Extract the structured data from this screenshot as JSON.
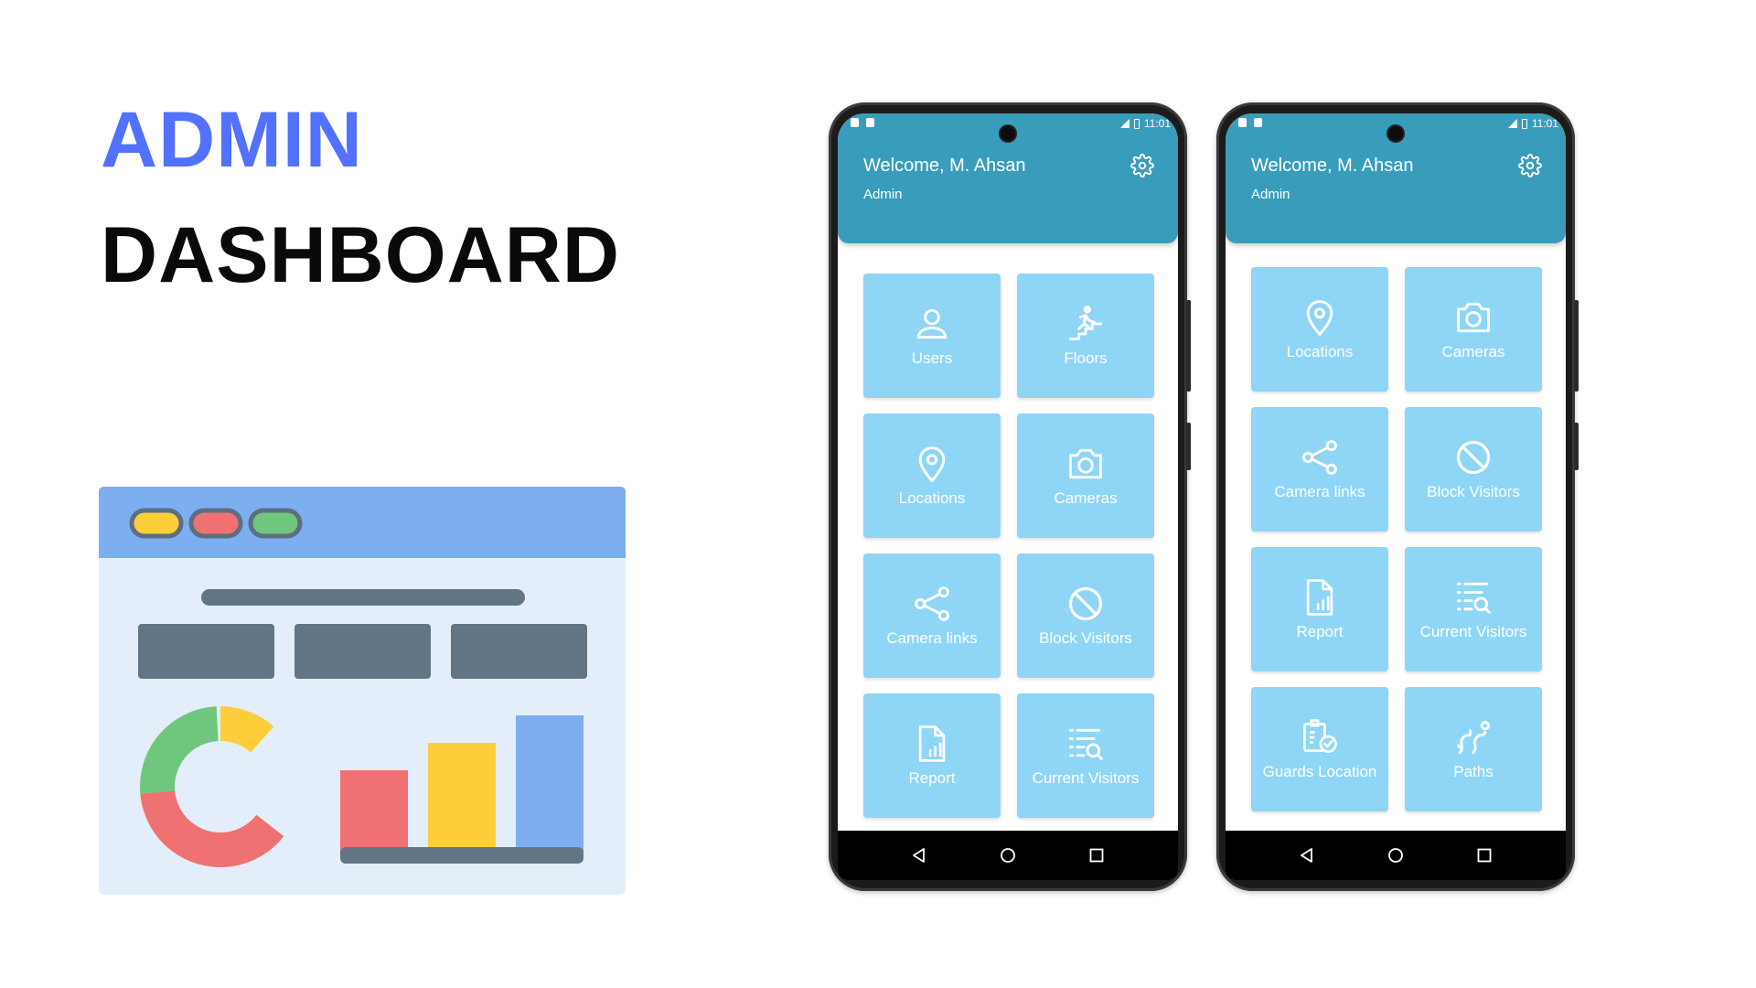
{
  "hero": {
    "line1": "ADMIN",
    "line2": "DASHBOARD"
  },
  "colors": {
    "accent": "#5271ff",
    "appbar": "#3a9cbb",
    "tile": "#8fd5f6",
    "illustration_header": "#7daeef",
    "illustration_body": "#e3eefa"
  },
  "phones": [
    {
      "status_time": "11:01",
      "welcome": "Welcome, M. Ahsan",
      "role": "Admin",
      "tiles": [
        {
          "icon": "user-icon",
          "label": "Users"
        },
        {
          "icon": "stairs-icon",
          "label": "Floors"
        },
        {
          "icon": "location-pin-icon",
          "label": "Locations"
        },
        {
          "icon": "camera-icon",
          "label": "Cameras"
        },
        {
          "icon": "share-icon",
          "label": "Camera links"
        },
        {
          "icon": "block-icon",
          "label": "Block Visitors"
        },
        {
          "icon": "report-icon",
          "label": "Report"
        },
        {
          "icon": "list-search-icon",
          "label": "Current Visitors"
        }
      ]
    },
    {
      "status_time": "11:01",
      "welcome": "Welcome, M. Ahsan",
      "role": "Admin",
      "tiles": [
        {
          "icon": "location-pin-icon",
          "label": "Locations"
        },
        {
          "icon": "camera-icon",
          "label": "Cameras"
        },
        {
          "icon": "share-icon",
          "label": "Camera links"
        },
        {
          "icon": "block-icon",
          "label": "Block Visitors"
        },
        {
          "icon": "report-icon",
          "label": "Report"
        },
        {
          "icon": "list-search-icon",
          "label": "Current Visitors"
        },
        {
          "icon": "guards-location-icon",
          "label": "Guards Location"
        },
        {
          "icon": "paths-icon",
          "label": "Paths"
        }
      ]
    }
  ]
}
